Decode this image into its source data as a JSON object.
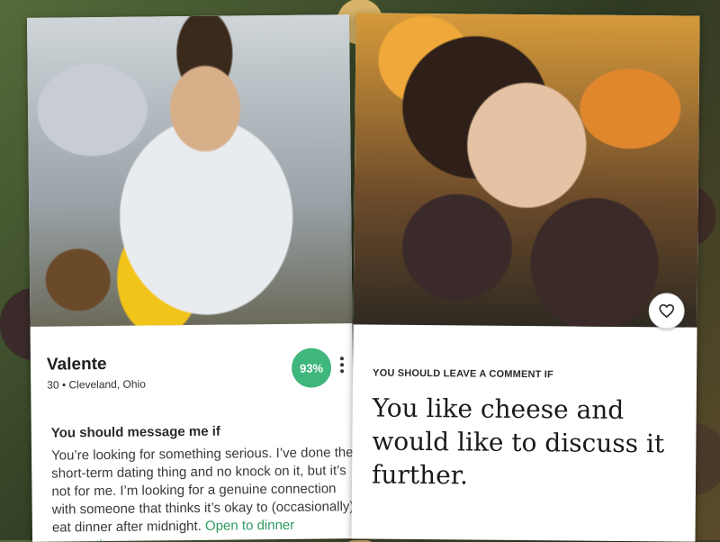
{
  "left_profile": {
    "name": "Valente",
    "meta": "30 • Cleveland, Ohio",
    "match_percent": "93%",
    "more_icon": "more-vertical-icon",
    "prompt_title": "You should message me if",
    "prompt_text_main": "You’re looking for something serious. I’ve done the short-term dating thing and no knock on it, but it’s not for me. I’m looking for a genuine connection with someone that thinks it’s okay to (occasionally) eat dinner after midnight. ",
    "prompt_text_highlight": "Open to dinner suggestions~",
    "accent_color": "#3fb67c"
  },
  "right_profile": {
    "like_icon": "heart-icon",
    "prompt_title": "YOU SHOULD LEAVE A COMMENT IF",
    "prompt_text": "You like cheese and would like to discuss it further."
  }
}
